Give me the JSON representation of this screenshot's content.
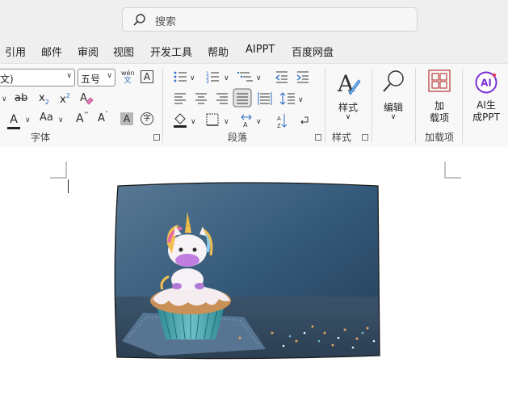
{
  "search": {
    "placeholder": "搜索",
    "icon": "search-icon"
  },
  "menu": {
    "items": [
      "引用",
      "邮件",
      "审阅",
      "视图",
      "开发工具",
      "帮助",
      "AIPPT",
      "百度网盘"
    ]
  },
  "font_group": {
    "font_name_fragment": "文)",
    "font_size": "五号",
    "phonetic_top": "wén",
    "phonetic_bottom": "文",
    "border_char": "A",
    "strike_label": "ab",
    "subscript_label": "x",
    "subscript_mark": "2",
    "superscript_label": "x",
    "superscript_mark": "2",
    "font_color_label": "A",
    "change_case_label": "Aa",
    "grow_label": "A",
    "shrink_label": "A",
    "shading_label": "A",
    "enclose_label": "字",
    "label": "字体"
  },
  "paragraph_group": {
    "label": "段落"
  },
  "styles_group": {
    "button": "样式",
    "label": "样式"
  },
  "editing_group": {
    "button": "编辑"
  },
  "addins_group": {
    "line1": "加",
    "line2": "载项",
    "label": "加载项"
  },
  "ai_group": {
    "line1": "AI生",
    "line2": "成PPT",
    "badge": "AI"
  },
  "colors": {
    "accent_orange": "#c0504d",
    "ai_purple": "#7a2fd6",
    "font_red": "#222222"
  }
}
